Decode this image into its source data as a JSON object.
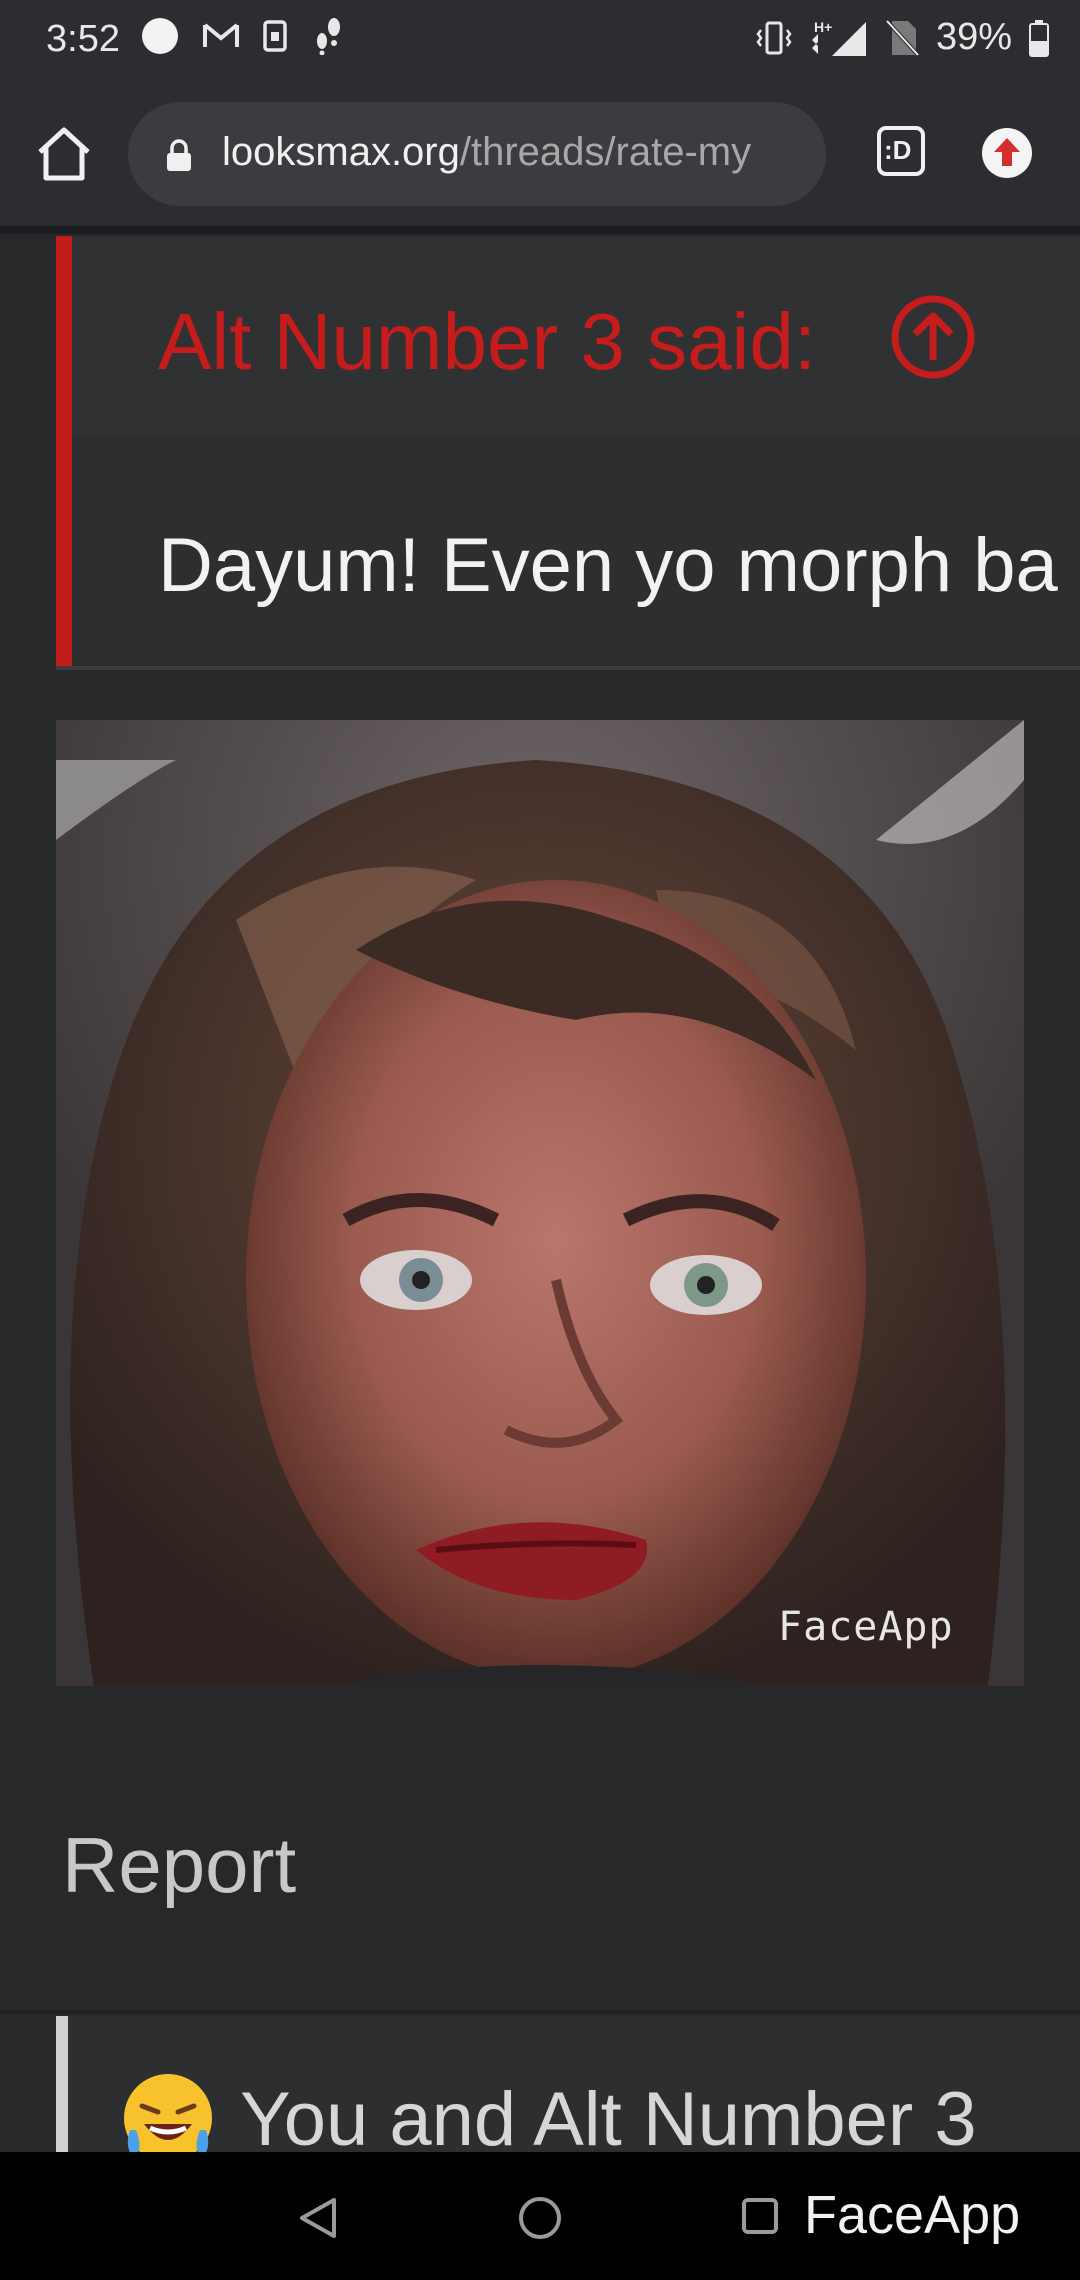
{
  "status_bar": {
    "time": "3:52",
    "battery": "39%",
    "icons_left": [
      "circle-icon",
      "gmail-icon",
      "sim-icon",
      "footsteps-icon"
    ],
    "icons_right": [
      "vibrate-icon",
      "signal-hplus-icon",
      "no-sim-icon",
      "battery-icon"
    ]
  },
  "browser": {
    "url_domain": "looksmax.org",
    "url_path": "/threads/rate-my",
    "tab_label": ":D"
  },
  "quote": {
    "attribution": "Alt Number 3 said:",
    "text": "Dayum! Even yo morph ba"
  },
  "image": {
    "watermark": "FaceApp"
  },
  "post_actions": {
    "report_label": "Report"
  },
  "reactions": {
    "text": "You and Alt Number 3"
  },
  "nav_bar": {
    "overlay_text": "FaceApp"
  },
  "colors": {
    "accent_red": "#c61c1c",
    "background": "#26282a"
  }
}
